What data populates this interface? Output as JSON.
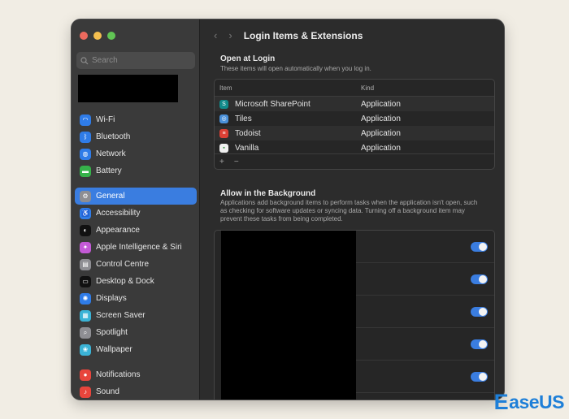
{
  "sidebar": {
    "search_placeholder": "Search",
    "groups": [
      [
        {
          "label": "Wi-Fi",
          "icon": "wifi-icon",
          "color": "#2f7ce8",
          "glyph": "◠"
        },
        {
          "label": "Bluetooth",
          "icon": "bluetooth-icon",
          "color": "#2f7ce8",
          "glyph": "ᛒ"
        },
        {
          "label": "Network",
          "icon": "globe-icon",
          "color": "#2f7ce8",
          "glyph": "◍"
        },
        {
          "label": "Battery",
          "icon": "battery-icon",
          "color": "#36b24a",
          "glyph": "▬"
        }
      ],
      [
        {
          "label": "General",
          "icon": "gear-icon",
          "color": "#8e8e93",
          "glyph": "⚙",
          "active": true
        },
        {
          "label": "Accessibility",
          "icon": "accessibility-icon",
          "color": "#2f7ce8",
          "glyph": "♿"
        },
        {
          "label": "Appearance",
          "icon": "appearance-icon",
          "color": "#111111",
          "glyph": "◐"
        },
        {
          "label": "Apple Intelligence & Siri",
          "icon": "siri-icon",
          "color": "#c35ad6",
          "glyph": "✦"
        },
        {
          "label": "Control Centre",
          "icon": "control-centre-icon",
          "color": "#8e8e93",
          "glyph": "▤"
        },
        {
          "label": "Desktop & Dock",
          "icon": "dock-icon",
          "color": "#111111",
          "glyph": "▭"
        },
        {
          "label": "Displays",
          "icon": "displays-icon",
          "color": "#2f7ce8",
          "glyph": "✺"
        },
        {
          "label": "Screen Saver",
          "icon": "screen-saver-icon",
          "color": "#3bb3d6",
          "glyph": "▦"
        },
        {
          "label": "Spotlight",
          "icon": "spotlight-icon",
          "color": "#8e8e93",
          "glyph": "⌕"
        },
        {
          "label": "Wallpaper",
          "icon": "wallpaper-icon",
          "color": "#3bb3d6",
          "glyph": "❀"
        }
      ],
      [
        {
          "label": "Notifications",
          "icon": "bell-icon",
          "color": "#e8453c",
          "glyph": "●"
        },
        {
          "label": "Sound",
          "icon": "speaker-icon",
          "color": "#e8453c",
          "glyph": "♪"
        }
      ]
    ]
  },
  "main": {
    "title": "Login Items & Extensions",
    "open_at_login": {
      "title": "Open at Login",
      "subtitle": "These items will open automatically when you log in.",
      "col_item": "Item",
      "col_kind": "Kind",
      "rows": [
        {
          "name": "Microsoft SharePoint",
          "kind": "Application",
          "icon": "sharepoint-icon",
          "color": "#108a8a",
          "glyph": "S"
        },
        {
          "name": "Tiles",
          "kind": "Application",
          "icon": "tiles-icon",
          "color": "#4a90d9",
          "glyph": "◎"
        },
        {
          "name": "Todoist",
          "kind": "Application",
          "icon": "todoist-icon",
          "color": "#db4035",
          "glyph": "≡"
        },
        {
          "name": "Vanilla",
          "kind": "Application",
          "icon": "vanilla-icon",
          "color": "#f0f0f0",
          "glyph": "▪"
        }
      ],
      "add_label": "+",
      "remove_label": "−"
    },
    "background": {
      "title": "Allow in the Background",
      "description": "Applications add background items to perform tasks when the application isn't open, such as checking for software updates or syncing data. Turning off a background item may prevent these tasks from being completed.",
      "toggles": [
        true,
        true,
        true,
        true,
        true
      ]
    }
  },
  "watermark": {
    "e": "E",
    "rest": "aseUS"
  }
}
